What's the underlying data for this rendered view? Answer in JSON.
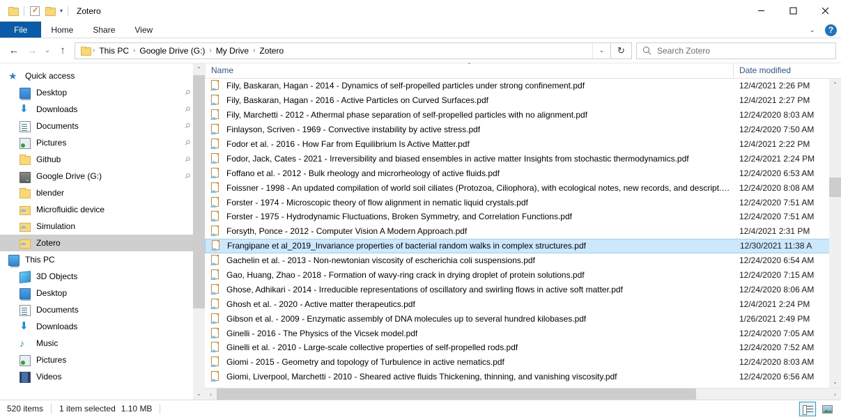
{
  "window": {
    "title": "Zotero",
    "quick_access_toolbar": [
      {
        "name": "folder-icon",
        "label": ""
      },
      {
        "name": "properties-icon",
        "label": ""
      },
      {
        "name": "new-folder-icon",
        "label": ""
      },
      {
        "name": "customize-caret-icon",
        "label": "▾"
      }
    ],
    "controls": {
      "minimize": "—",
      "maximize": "☐",
      "close": "✕"
    }
  },
  "ribbon": {
    "tabs": [
      {
        "id": "file",
        "label": "File"
      },
      {
        "id": "home",
        "label": "Home"
      },
      {
        "id": "share",
        "label": "Share"
      },
      {
        "id": "view",
        "label": "View"
      }
    ],
    "minimize_caret": "⌄",
    "help_label": "?"
  },
  "address": {
    "back": "←",
    "forward": "→",
    "recent_caret": "⌄",
    "up": "↑",
    "breadcrumbs": [
      "This PC",
      "Google Drive (G:)",
      "My Drive",
      "Zotero"
    ],
    "separator": "›",
    "dropdown_caret": "⌄",
    "refresh": "↻"
  },
  "search": {
    "placeholder": "Search Zotero",
    "value": "",
    "icon": "search-icon"
  },
  "sidebar": {
    "items": [
      {
        "label": "Quick access",
        "icon": "star-icon",
        "level": 0,
        "pinned": false,
        "selected": false
      },
      {
        "label": "Desktop",
        "icon": "monitor-icon",
        "level": 1,
        "pinned": true,
        "selected": false
      },
      {
        "label": "Downloads",
        "icon": "download-arrow-icon",
        "level": 1,
        "pinned": true,
        "selected": false
      },
      {
        "label": "Documents",
        "icon": "document-icon",
        "level": 1,
        "pinned": true,
        "selected": false
      },
      {
        "label": "Pictures",
        "icon": "pictures-icon",
        "level": 1,
        "pinned": true,
        "selected": false
      },
      {
        "label": "Github",
        "icon": "folder-icon",
        "level": 1,
        "pinned": true,
        "selected": false
      },
      {
        "label": "Google Drive (G:)",
        "icon": "drive-icon",
        "level": 1,
        "pinned": true,
        "selected": false
      },
      {
        "label": "blender",
        "icon": "folder-icon",
        "level": 1,
        "pinned": false,
        "selected": false
      },
      {
        "label": "Microfluidic device",
        "icon": "cloud-folder-icon",
        "level": 1,
        "pinned": false,
        "selected": false
      },
      {
        "label": "Simulation",
        "icon": "cloud-folder-icon",
        "level": 1,
        "pinned": false,
        "selected": false
      },
      {
        "label": "Zotero",
        "icon": "cloud-folder-icon",
        "level": 1,
        "pinned": false,
        "selected": true
      },
      {
        "label": "This PC",
        "icon": "pc-icon",
        "level": 0,
        "pinned": false,
        "selected": false
      },
      {
        "label": "3D Objects",
        "icon": "3d-objects-icon",
        "level": 1,
        "pinned": false,
        "selected": false
      },
      {
        "label": "Desktop",
        "icon": "monitor-icon",
        "level": 1,
        "pinned": false,
        "selected": false
      },
      {
        "label": "Documents",
        "icon": "document-icon",
        "level": 1,
        "pinned": false,
        "selected": false
      },
      {
        "label": "Downloads",
        "icon": "download-arrow-icon",
        "level": 1,
        "pinned": false,
        "selected": false
      },
      {
        "label": "Music",
        "icon": "music-note-icon",
        "level": 1,
        "pinned": false,
        "selected": false
      },
      {
        "label": "Pictures",
        "icon": "pictures-icon",
        "level": 1,
        "pinned": false,
        "selected": false
      },
      {
        "label": "Videos",
        "icon": "video-icon",
        "level": 1,
        "pinned": false,
        "selected": false
      }
    ],
    "scroll_up": "⌃",
    "scroll_down": "⌄"
  },
  "filelist": {
    "columns": [
      {
        "id": "name",
        "label": "Name",
        "sorted": "asc",
        "sort_caret": "⌃"
      },
      {
        "id": "date",
        "label": "Date modified",
        "sorted": "none"
      }
    ],
    "rows": [
      {
        "name": "Fily, Baskaran, Hagan - 2014 - Dynamics of self-propelled particles under strong confinement.pdf",
        "date": "12/4/2021 2:26 PM",
        "selected": false
      },
      {
        "name": "Fily, Baskaran, Hagan - 2016 - Active Particles on Curved Surfaces.pdf",
        "date": "12/4/2021 2:27 PM",
        "selected": false
      },
      {
        "name": "Fily, Marchetti - 2012 - Athermal phase separation of self-propelled particles with no alignment.pdf",
        "date": "12/24/2020 8:03 AM",
        "selected": false
      },
      {
        "name": "Finlayson, Scriven - 1969 - Convective instability by active stress.pdf",
        "date": "12/24/2020 7:50 AM",
        "selected": false
      },
      {
        "name": "Fodor et al. - 2016 - How Far from Equilibrium Is Active Matter.pdf",
        "date": "12/4/2021 2:22 PM",
        "selected": false
      },
      {
        "name": "Fodor, Jack, Cates - 2021 - Irreversibility and biased ensembles in active matter Insights from stochastic thermodynamics.pdf",
        "date": "12/24/2021 2:24 PM",
        "selected": false
      },
      {
        "name": "Foffano et al. - 2012 - Bulk rheology and microrheology of active fluids.pdf",
        "date": "12/24/2020 6:53 AM",
        "selected": false
      },
      {
        "name": "Foissner - 1998 - An updated compilation of world soil ciliates (Protozoa, Ciliophora), with ecological notes, new records, and descript.p...",
        "date": "12/24/2020 8:08 AM",
        "selected": false
      },
      {
        "name": "Forster - 1974 - Microscopic theory of flow alignment in nematic liquid crystals.pdf",
        "date": "12/24/2020 7:51 AM",
        "selected": false
      },
      {
        "name": "Forster - 1975 - Hydrodynamic Fluctuations, Broken Symmetry, and Correlation Functions.pdf",
        "date": "12/24/2020 7:51 AM",
        "selected": false
      },
      {
        "name": "Forsyth, Ponce - 2012 - Computer Vision A Modern Approach.pdf",
        "date": "12/4/2021 2:31 PM",
        "selected": false
      },
      {
        "name": "Frangipane et al_2019_Invariance properties of bacterial random walks in complex structures.pdf",
        "date": "12/30/2021 11:38 A",
        "selected": true
      },
      {
        "name": "Gachelin et al. - 2013 - Non-newtonian viscosity of escherichia coli suspensions.pdf",
        "date": "12/24/2020 6:54 AM",
        "selected": false
      },
      {
        "name": "Gao, Huang, Zhao - 2018 - Formation of wavy-ring crack in drying droplet of protein solutions.pdf",
        "date": "12/24/2020 7:15 AM",
        "selected": false
      },
      {
        "name": "Ghose, Adhikari - 2014 - Irreducible representations of oscillatory and swirling flows in active soft matter.pdf",
        "date": "12/24/2020 8:06 AM",
        "selected": false
      },
      {
        "name": "Ghosh et al. - 2020 - Active matter therapeutics.pdf",
        "date": "12/4/2021 2:24 PM",
        "selected": false
      },
      {
        "name": "Gibson et al. - 2009 - Enzymatic assembly of DNA molecules up to several hundred kilobases.pdf",
        "date": "1/26/2021 2:49 PM",
        "selected": false
      },
      {
        "name": "Ginelli - 2016 - The Physics of the Vicsek model.pdf",
        "date": "12/24/2020 7:05 AM",
        "selected": false
      },
      {
        "name": "Ginelli et al. - 2010 - Large-scale collective properties of self-propelled rods.pdf",
        "date": "12/24/2020 7:52 AM",
        "selected": false
      },
      {
        "name": "Giomi - 2015 - Geometry and topology of Turbulence in active nematics.pdf",
        "date": "12/24/2020 8:03 AM",
        "selected": false
      },
      {
        "name": "Giomi, Liverpool, Marchetti - 2010 - Sheared active fluids Thickening, thinning, and vanishing viscosity.pdf",
        "date": "12/24/2020 6:56 AM",
        "selected": false
      }
    ],
    "scroll_up": "⌃",
    "scroll_down": "⌄",
    "scroll_left": "‹",
    "scroll_right": "›"
  },
  "status": {
    "item_count": "520 items",
    "selection": "1 item selected",
    "selection_size": "1.10 MB",
    "view_buttons": [
      {
        "name": "details-view-button",
        "active": true
      },
      {
        "name": "large-icons-view-button",
        "active": false
      }
    ]
  },
  "colors": {
    "file_tab_blue": "#0a5ca8",
    "selection_blue": "#cce8ff",
    "selection_border": "#99d1ff",
    "sidebar_selected_gray": "#cfcfcf",
    "header_link_blue": "#2a5699",
    "help_blue": "#1b74c4"
  }
}
